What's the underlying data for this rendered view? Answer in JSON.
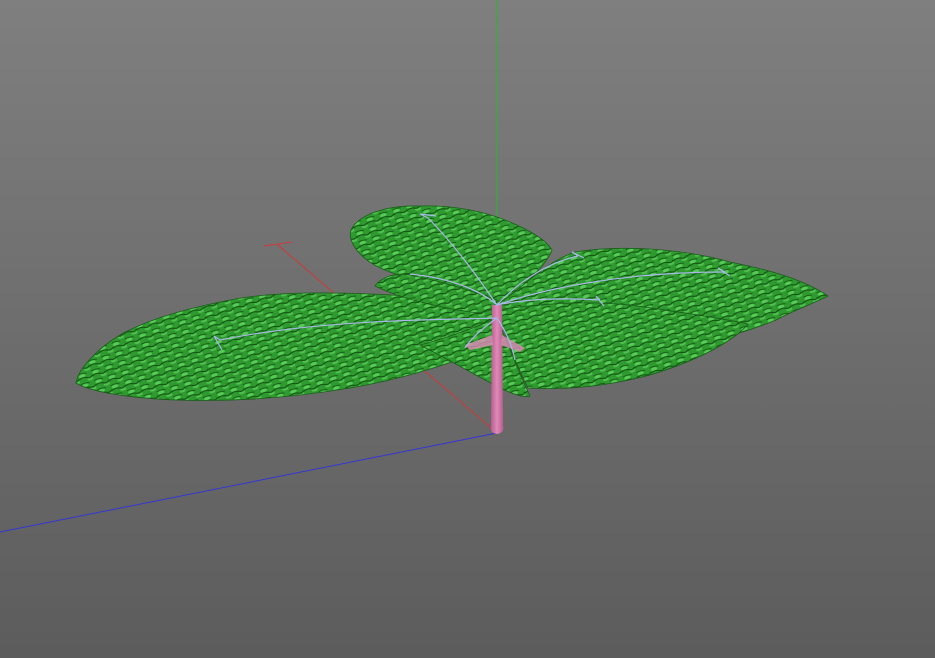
{
  "viewport": {
    "background_top": "#7f7f7f",
    "background_bottom": "#5c5c5c"
  },
  "axes": {
    "x_color": "#cc3a3a",
    "y_color": "#2bb52b",
    "z_color": "#3535d6"
  },
  "model": {
    "leaf_color": "#2f9a2f",
    "leaf_highlight": "#5ed25e",
    "leaf_shadow": "#0f4f0f",
    "stem_color": "#e08ab8",
    "stem_shadow": "#b45c8c",
    "skeleton_color": "#a8b8e8"
  }
}
